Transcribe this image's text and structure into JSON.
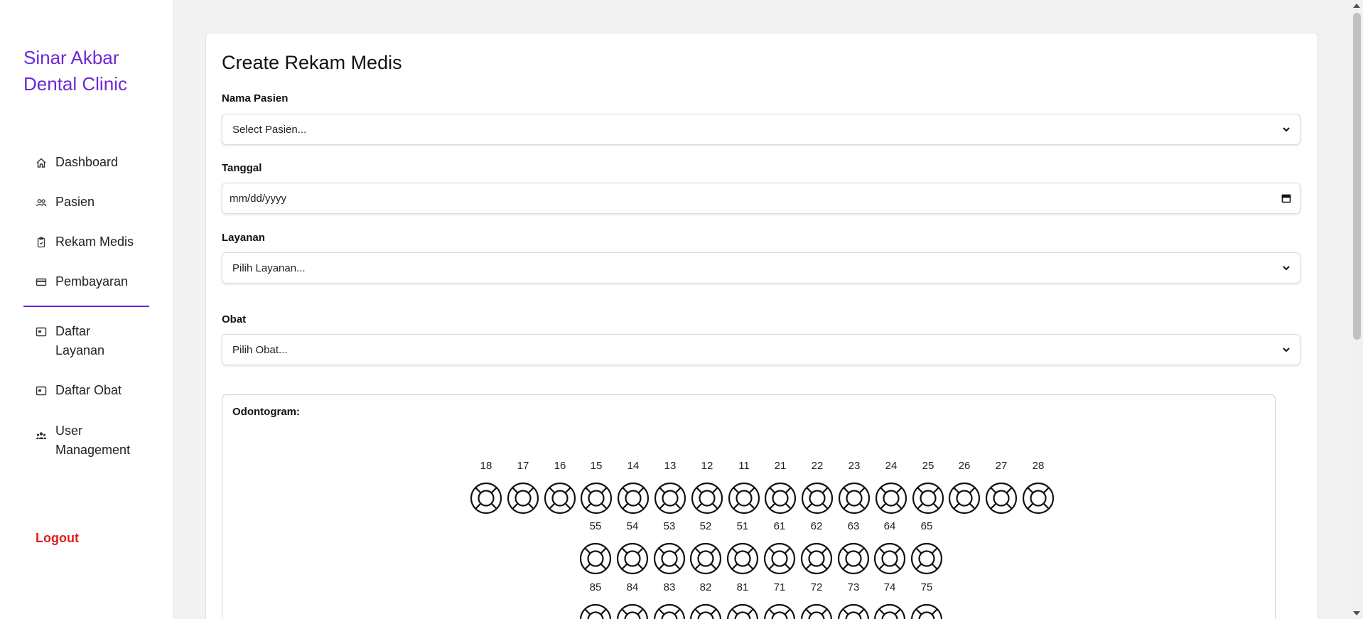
{
  "brand": {
    "line1": "Sinar Akbar",
    "line2": "Dental Clinic"
  },
  "nav": {
    "primary": [
      {
        "label": "Dashboard",
        "icon": "home-icon"
      },
      {
        "label": "Pasien",
        "icon": "users-icon"
      },
      {
        "label": "Rekam Medis",
        "icon": "clipboard-icon"
      },
      {
        "label": "Pembayaran",
        "icon": "credit-card-icon"
      }
    ],
    "secondary": [
      {
        "label_line1": "Daftar",
        "label_line2": "Layanan",
        "icon": "list-window-icon"
      },
      {
        "label": "Daftar Obat",
        "icon": "list-window-icon"
      },
      {
        "label_line1": "User",
        "label_line2": "Management",
        "icon": "user-group-icon"
      }
    ],
    "logout": "Logout"
  },
  "form": {
    "title": "Create Rekam Medis",
    "nama_pasien": {
      "label": "Nama Pasien",
      "value": "Select Pasien..."
    },
    "tanggal": {
      "label": "Tanggal",
      "placeholder": "mm/dd/yyyy"
    },
    "layanan": {
      "label": "Layanan",
      "value": "Pilih Layanan..."
    },
    "obat": {
      "label": "Obat",
      "value": "Pilih Obat..."
    }
  },
  "odontogram": {
    "label": "Odontogram:",
    "rows": [
      [
        "18",
        "17",
        "16",
        "15",
        "14",
        "13",
        "12",
        "11",
        "21",
        "22",
        "23",
        "24",
        "25",
        "26",
        "27",
        "28"
      ],
      [
        "55",
        "54",
        "53",
        "52",
        "51",
        "61",
        "62",
        "63",
        "64",
        "65"
      ],
      [
        "85",
        "84",
        "83",
        "82",
        "81",
        "71",
        "72",
        "73",
        "74",
        "75"
      ]
    ]
  },
  "colors": {
    "brand": "#6d28d9",
    "logout": "#e11d1d"
  }
}
